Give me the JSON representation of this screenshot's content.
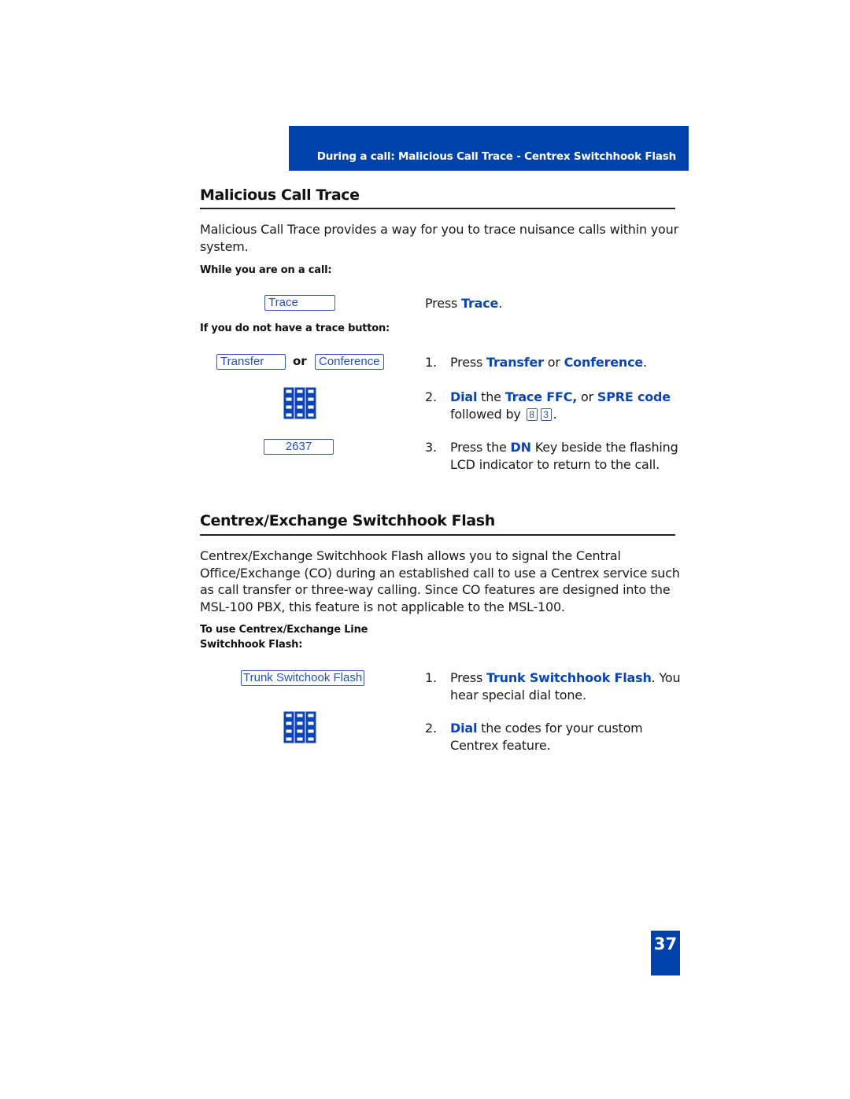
{
  "header": {
    "title": "During a call: Malicious Call Trace - Centrex Switchhook Flash",
    "band_color": "#0041aa"
  },
  "sections": {
    "trace": {
      "title": "Malicious Call Trace",
      "intro": "Malicious Call Trace provides a way for you to trace nuisance calls within your system.",
      "label_on_call": "While you are on a call:",
      "trace_key": "Trace",
      "press_trace": {
        "prefix": "Press ",
        "key": "Trace",
        "suffix": "."
      },
      "label_no_button": "If you do not have a trace button:",
      "transfer_key": "Transfer",
      "or_label": "or",
      "conference_key": "Conference",
      "dn_key": "2637",
      "keypad_icon": "dialpad-icon",
      "steps": [
        {
          "num": "1.",
          "parts": [
            {
              "t": "Press ",
              "hl": false
            },
            {
              "t": "Transfer",
              "hl": true
            },
            {
              "t": " or ",
              "hl": false
            },
            {
              "t": "Conference",
              "hl": true
            },
            {
              "t": ".",
              "hl": false
            }
          ]
        },
        {
          "num": "2.",
          "parts": [
            {
              "t": "Dial",
              "hl": true
            },
            {
              "t": " the ",
              "hl": false
            },
            {
              "t": "Trace FFC,",
              "hl": true
            },
            {
              "t": " or ",
              "hl": false
            },
            {
              "t": "SPRE code",
              "hl": true
            }
          ],
          "line2_prefix": "followed by ",
          "digit_keys": [
            "8",
            "3"
          ],
          "line2_suffix": "."
        },
        {
          "num": "3.",
          "parts": [
            {
              "t": "Press the ",
              "hl": false
            },
            {
              "t": "DN",
              "hl": true
            },
            {
              "t": " Key beside the flashing LCD indicator to return to the call.",
              "hl": false
            }
          ]
        }
      ]
    },
    "switchhook": {
      "title": "Centrex/Exchange Switchhook Flash",
      "intro": "Centrex/Exchange Switchhook Flash allows you to signal the Central Office/Exchange (CO) during an established call to use a Centrex service such as call transfer or three-way calling. Since CO features are designed into the MSL-100 PBX, this feature is not applicable to the MSL-100.",
      "label_use_line1": "To use Centrex/Exchange Line",
      "label_use_line2": "Switchhook Flash:",
      "trunk_key": "Trunk Switchook Flash",
      "keypad_icon": "dialpad-icon",
      "steps": [
        {
          "num": "1.",
          "parts": [
            {
              "t": "Press ",
              "hl": false
            },
            {
              "t": "Trunk Switchhook Flash",
              "hl": true
            },
            {
              "t": ". You hear special dial tone.",
              "hl": false
            }
          ]
        },
        {
          "num": "2.",
          "parts": [
            {
              "t": "Dial",
              "hl": true
            },
            {
              "t": " the codes for your custom Centrex feature.",
              "hl": false
            }
          ]
        }
      ]
    }
  },
  "page_number": "37",
  "colors": {
    "accent": "#0b45b5",
    "key_border": "#3a5cb0"
  }
}
